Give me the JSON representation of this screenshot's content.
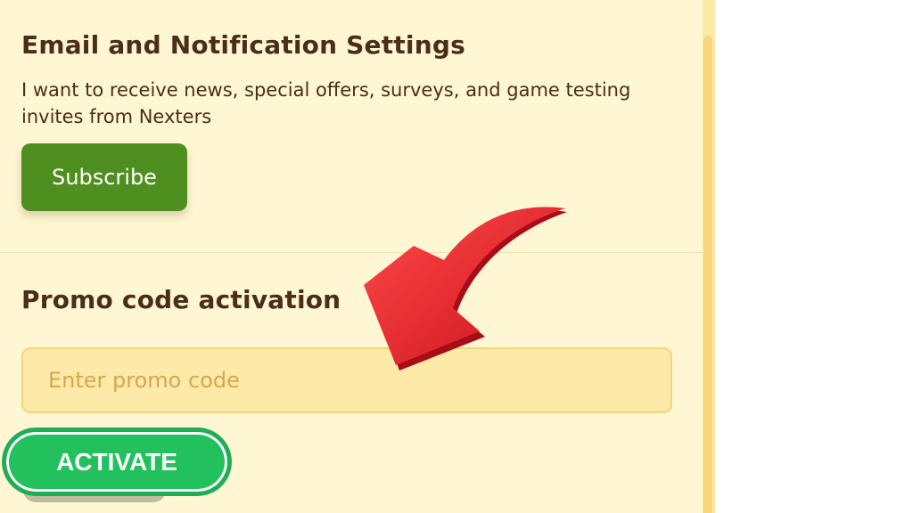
{
  "email_settings": {
    "title": "Email and Notification Settings",
    "description": "I want to receive news, special offers, surveys, and game testing invites from Nexters",
    "subscribe_label": "Subscribe"
  },
  "promo": {
    "title": "Promo code activation",
    "input_placeholder": "Enter promo code",
    "input_value": "",
    "activate_label": "ACTIVATE"
  },
  "overlay": {
    "arrow_icon": "curved-arrow-icon",
    "arrow_color": "#e8212b"
  },
  "colors": {
    "panel_bg": "#fff7d4",
    "title_text": "#4a2e17",
    "subscribe_bg": "#4f8f1f",
    "activate_bg": "#22c15e",
    "input_bg": "#fde9a8",
    "placeholder": "#d6a74f"
  }
}
